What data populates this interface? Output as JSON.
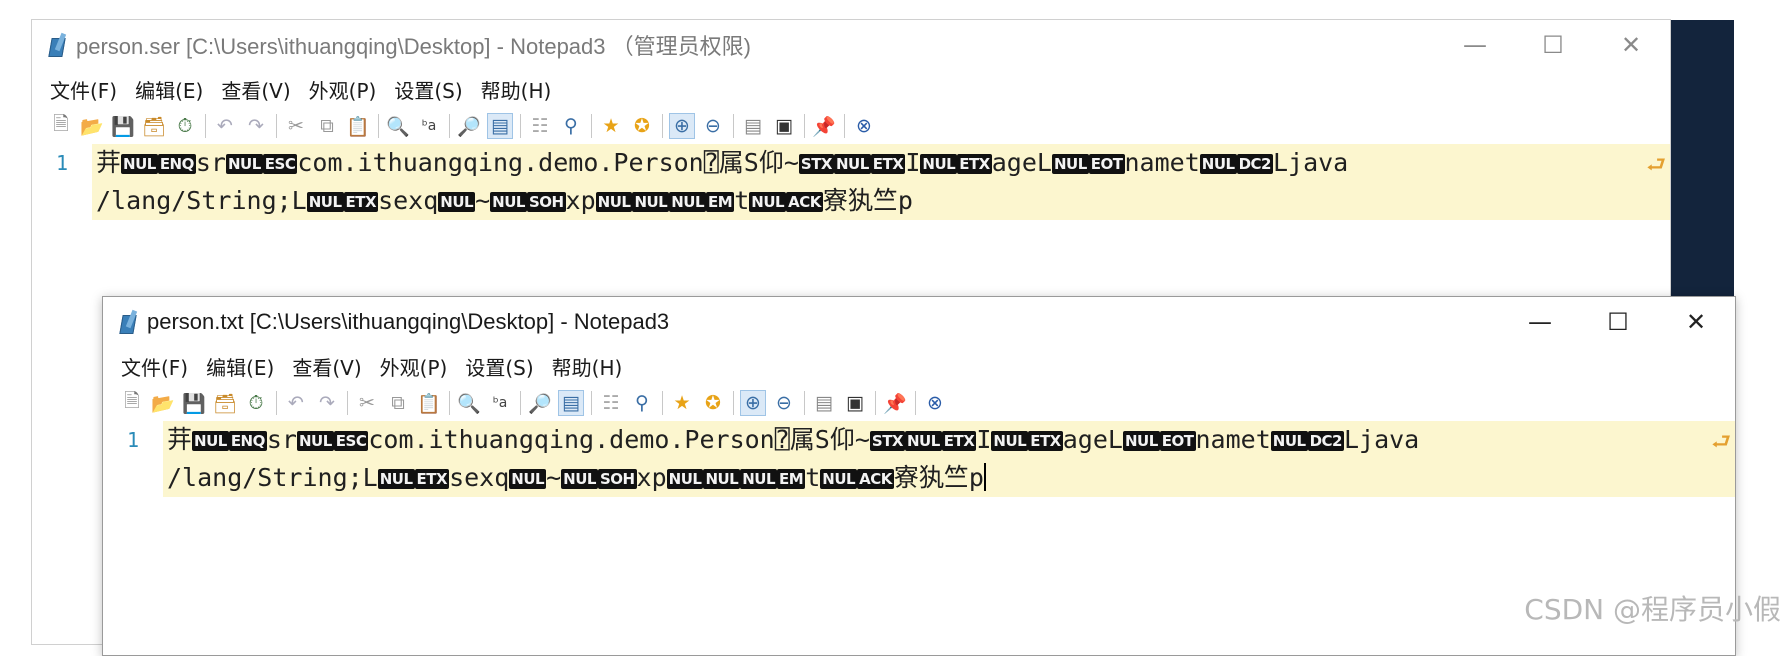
{
  "back_window": {
    "title": "person.ser [C:\\Users\\ithuangqing\\Desktop] - Notepad3  （管理员权限)",
    "controls": {
      "minimize": "—",
      "maximize": "☐",
      "close": "✕"
    },
    "menu": [
      "文件(F)",
      "编辑(E)",
      "查看(V)",
      "外观(P)",
      "设置(S)",
      "帮助(H)"
    ],
    "line_number": "1",
    "line1_text": [
      "茾",
      "sr",
      "com.ithuangqing.demo.Person⍰属S仰~",
      "I",
      "ageL",
      "namet",
      "Ljava"
    ],
    "line2_text": [
      "/lang/String;L",
      "sexq",
      "~",
      "xp",
      "t",
      "寮犱竺p"
    ]
  },
  "front_window": {
    "title": "person.txt [C:\\Users\\ithuangqing\\Desktop] - Notepad3",
    "controls": {
      "minimize": "—",
      "maximize": "☐",
      "close": "✕"
    },
    "menu": [
      "文件(F)",
      "编辑(E)",
      "查看(V)",
      "外观(P)",
      "设置(S)",
      "帮助(H)"
    ],
    "line_number": "1",
    "line1_text": [
      "茾",
      "sr",
      "com.ithuangqing.demo.Person⍰属S仰~",
      "I",
      "ageL",
      "namet",
      "Ljava"
    ],
    "line2_text": [
      "/lang/String;L",
      "sexq",
      "~",
      "xp",
      "t",
      "寮犱竺p"
    ]
  },
  "control_chars": {
    "nul": "NUL",
    "enq": "ENQ",
    "esc": "ESC",
    "stx": "STX",
    "etx": "ETX",
    "eot": "EOT",
    "dc2": "DC2",
    "soh": "SOH",
    "em": "EM",
    "ack": "ACK"
  },
  "toolbar_icons": [
    "new-file-icon",
    "open-folder-icon",
    "save-icon",
    "save-as-icon",
    "revert-icon",
    "undo-icon",
    "redo-icon",
    "cut-icon",
    "copy-icon",
    "paste-icon",
    "find-icon",
    "replace-icon",
    "goto-icon",
    "word-wrap-icon",
    "select-icon",
    "find-next-icon",
    "favorite-icon",
    "add-favorite-icon",
    "zoom-in-icon",
    "zoom-out-icon",
    "scheme-icon",
    "fullscreen-icon",
    "pin-icon",
    "exit-icon"
  ],
  "wrap_indicator": "⮐",
  "watermark": "CSDN @程序员小假"
}
